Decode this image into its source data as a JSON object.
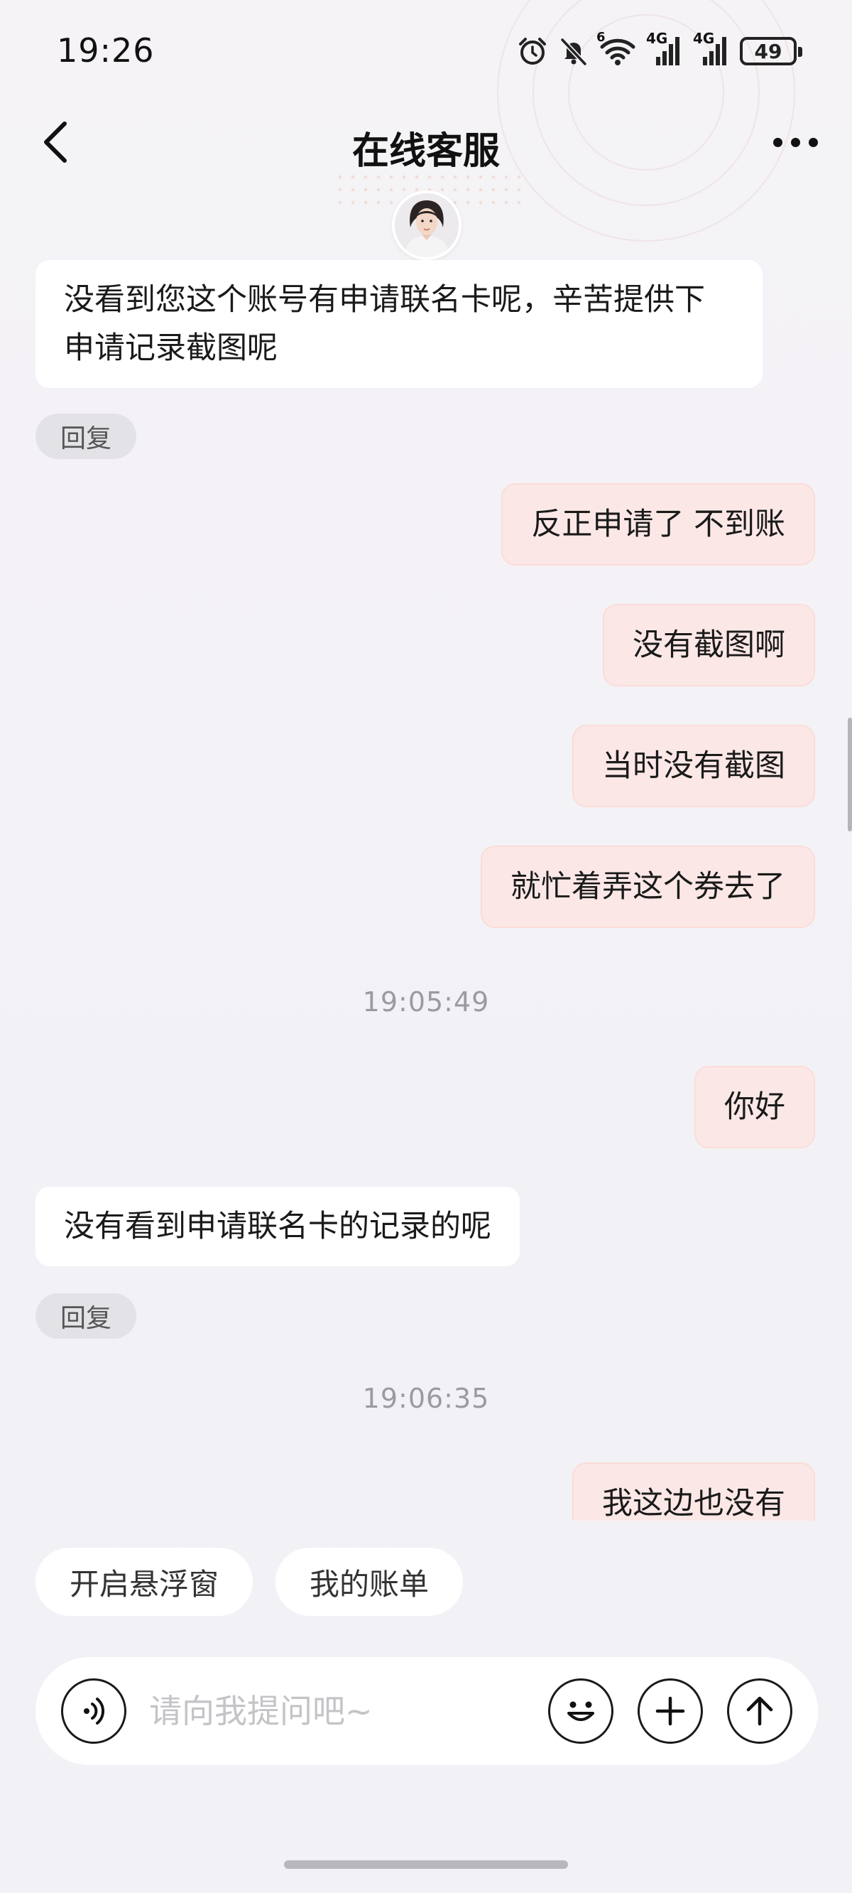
{
  "status_bar": {
    "time": "19:26",
    "network_1": "4G",
    "network_2": "4G",
    "wifi_badge": "6",
    "battery": "49"
  },
  "header": {
    "title": "在线客服"
  },
  "messages": [
    {
      "role": "agent",
      "text": "没看到您这个账号有申请联名卡呢，辛苦提供下申请记录截图呢",
      "reply_label": "回复"
    },
    {
      "role": "user",
      "text": "反正申请了 不到账"
    },
    {
      "role": "user",
      "text": "没有截图啊"
    },
    {
      "role": "user",
      "text": "当时没有截图"
    },
    {
      "role": "user",
      "text": "就忙着弄这个券去了"
    },
    {
      "role": "timestamp",
      "text": "19:05:49"
    },
    {
      "role": "user",
      "text": "你好"
    },
    {
      "role": "agent",
      "text": "没有看到申请联名卡的记录的呢",
      "reply_label": "回复"
    },
    {
      "role": "timestamp",
      "text": "19:06:35"
    },
    {
      "role": "user",
      "text": "我这边也没有"
    }
  ],
  "quick_actions": [
    "开启悬浮窗",
    "我的账单"
  ],
  "input": {
    "placeholder": "请向我提问吧~",
    "value": ""
  },
  "colors": {
    "user_bubble": "#fbe8e6",
    "agent_bubble": "#ffffff",
    "background": "#f3f2f6"
  }
}
